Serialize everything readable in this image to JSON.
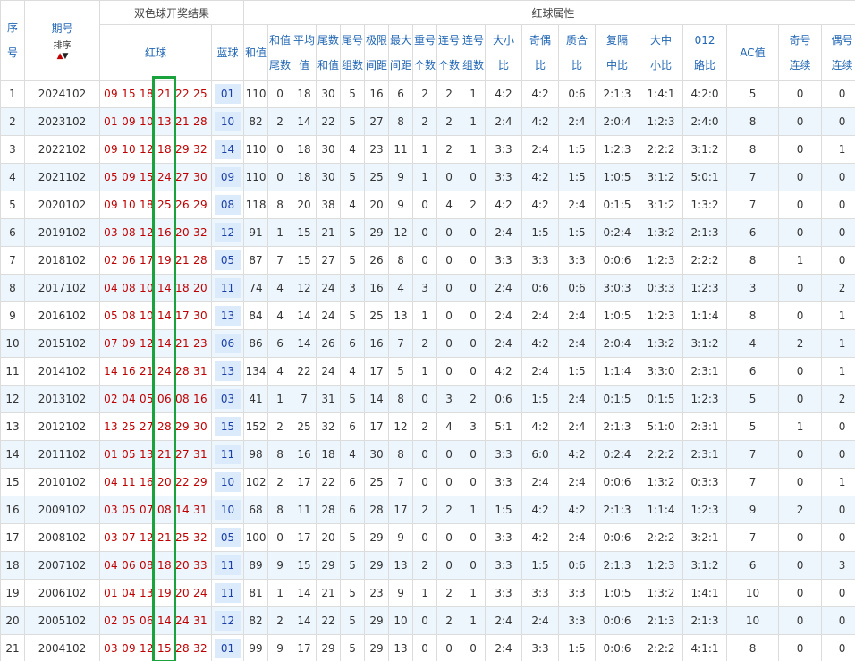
{
  "header": {
    "seq": [
      "序",
      "号"
    ],
    "period": "期号",
    "sort_label": "排序",
    "group_result": "双色球开奖结果",
    "group_attr": "红球属性",
    "red": "红球",
    "blue": "蓝球",
    "attr_cols": [
      [
        "和值"
      ],
      [
        "和值",
        "尾数"
      ],
      [
        "平均",
        "值"
      ],
      [
        "尾数",
        "和值"
      ],
      [
        "尾号",
        "组数"
      ],
      [
        "极限",
        "间距"
      ],
      [
        "最大",
        "间距"
      ],
      [
        "重号",
        "个数"
      ],
      [
        "连号",
        "个数"
      ],
      [
        "连号",
        "组数"
      ],
      [
        "大小",
        "比"
      ],
      [
        "奇偶",
        "比"
      ],
      [
        "质合",
        "比"
      ],
      [
        "复隔",
        "中比"
      ],
      [
        "大中",
        "小比"
      ],
      [
        "012",
        "路比"
      ],
      [
        "AC值"
      ],
      [
        "奇号",
        "连续"
      ],
      [
        "偶号",
        "连续"
      ]
    ]
  },
  "rows": [
    [
      "1",
      "2024102",
      "09 15 18 21 22 25",
      "01",
      "110",
      "0",
      "18",
      "30",
      "5",
      "16",
      "6",
      "2",
      "2",
      "1",
      "4:2",
      "4:2",
      "0:6",
      "2:1:3",
      "1:4:1",
      "4:2:0",
      "5",
      "0",
      "0"
    ],
    [
      "2",
      "2023102",
      "01 09 10 13 21 28",
      "10",
      "82",
      "2",
      "14",
      "22",
      "5",
      "27",
      "8",
      "2",
      "2",
      "1",
      "2:4",
      "4:2",
      "2:4",
      "2:0:4",
      "1:2:3",
      "2:4:0",
      "8",
      "0",
      "0"
    ],
    [
      "3",
      "2022102",
      "09 10 12 18 29 32",
      "14",
      "110",
      "0",
      "18",
      "30",
      "4",
      "23",
      "11",
      "1",
      "2",
      "1",
      "3:3",
      "2:4",
      "1:5",
      "1:2:3",
      "2:2:2",
      "3:1:2",
      "8",
      "0",
      "1"
    ],
    [
      "4",
      "2021102",
      "05 09 15 24 27 30",
      "09",
      "110",
      "0",
      "18",
      "30",
      "5",
      "25",
      "9",
      "1",
      "0",
      "0",
      "3:3",
      "4:2",
      "1:5",
      "1:0:5",
      "3:1:2",
      "5:0:1",
      "7",
      "0",
      "0"
    ],
    [
      "5",
      "2020102",
      "09 10 18 25 26 29",
      "08",
      "118",
      "8",
      "20",
      "38",
      "4",
      "20",
      "9",
      "0",
      "4",
      "2",
      "4:2",
      "4:2",
      "2:4",
      "0:1:5",
      "3:1:2",
      "1:3:2",
      "7",
      "0",
      "0"
    ],
    [
      "6",
      "2019102",
      "03 08 12 16 20 32",
      "12",
      "91",
      "1",
      "15",
      "21",
      "5",
      "29",
      "12",
      "0",
      "0",
      "0",
      "2:4",
      "1:5",
      "1:5",
      "0:2:4",
      "1:3:2",
      "2:1:3",
      "6",
      "0",
      "0"
    ],
    [
      "7",
      "2018102",
      "02 06 17 19 21 28",
      "05",
      "87",
      "7",
      "15",
      "27",
      "5",
      "26",
      "8",
      "0",
      "0",
      "0",
      "3:3",
      "3:3",
      "3:3",
      "0:0:6",
      "1:2:3",
      "2:2:2",
      "8",
      "1",
      "0"
    ],
    [
      "8",
      "2017102",
      "04 08 10 14 18 20",
      "11",
      "74",
      "4",
      "12",
      "24",
      "3",
      "16",
      "4",
      "3",
      "0",
      "0",
      "2:4",
      "0:6",
      "0:6",
      "3:0:3",
      "0:3:3",
      "1:2:3",
      "3",
      "0",
      "2"
    ],
    [
      "9",
      "2016102",
      "05 08 10 14 17 30",
      "13",
      "84",
      "4",
      "14",
      "24",
      "5",
      "25",
      "13",
      "1",
      "0",
      "0",
      "2:4",
      "2:4",
      "2:4",
      "1:0:5",
      "1:2:3",
      "1:1:4",
      "8",
      "0",
      "1"
    ],
    [
      "10",
      "2015102",
      "07 09 12 14 21 23",
      "06",
      "86",
      "6",
      "14",
      "26",
      "6",
      "16",
      "7",
      "2",
      "0",
      "0",
      "2:4",
      "4:2",
      "2:4",
      "2:0:4",
      "1:3:2",
      "3:1:2",
      "4",
      "2",
      "1"
    ],
    [
      "11",
      "2014102",
      "14 16 21 24 28 31",
      "13",
      "134",
      "4",
      "22",
      "24",
      "4",
      "17",
      "5",
      "1",
      "0",
      "0",
      "4:2",
      "2:4",
      "1:5",
      "1:1:4",
      "3:3:0",
      "2:3:1",
      "6",
      "0",
      "1"
    ],
    [
      "12",
      "2013102",
      "02 04 05 06 08 16",
      "03",
      "41",
      "1",
      "7",
      "31",
      "5",
      "14",
      "8",
      "0",
      "3",
      "2",
      "0:6",
      "1:5",
      "2:4",
      "0:1:5",
      "0:1:5",
      "1:2:3",
      "5",
      "0",
      "2"
    ],
    [
      "13",
      "2012102",
      "13 25 27 28 29 30",
      "15",
      "152",
      "2",
      "25",
      "32",
      "6",
      "17",
      "12",
      "2",
      "4",
      "3",
      "5:1",
      "4:2",
      "2:4",
      "2:1:3",
      "5:1:0",
      "2:3:1",
      "5",
      "1",
      "0"
    ],
    [
      "14",
      "2011102",
      "01 05 13 21 27 31",
      "11",
      "98",
      "8",
      "16",
      "18",
      "4",
      "30",
      "8",
      "0",
      "0",
      "0",
      "3:3",
      "6:0",
      "4:2",
      "0:2:4",
      "2:2:2",
      "2:3:1",
      "7",
      "0",
      "0"
    ],
    [
      "15",
      "2010102",
      "04 11 16 20 22 29",
      "10",
      "102",
      "2",
      "17",
      "22",
      "6",
      "25",
      "7",
      "0",
      "0",
      "0",
      "3:3",
      "2:4",
      "2:4",
      "0:0:6",
      "1:3:2",
      "0:3:3",
      "7",
      "0",
      "1"
    ],
    [
      "16",
      "2009102",
      "03 05 07 08 14 31",
      "10",
      "68",
      "8",
      "11",
      "28",
      "6",
      "28",
      "17",
      "2",
      "2",
      "1",
      "1:5",
      "4:2",
      "4:2",
      "2:1:3",
      "1:1:4",
      "1:2:3",
      "9",
      "2",
      "0"
    ],
    [
      "17",
      "2008102",
      "03 07 12 21 25 32",
      "05",
      "100",
      "0",
      "17",
      "20",
      "5",
      "29",
      "9",
      "0",
      "0",
      "0",
      "3:3",
      "4:2",
      "2:4",
      "0:0:6",
      "2:2:2",
      "3:2:1",
      "7",
      "0",
      "0"
    ],
    [
      "18",
      "2007102",
      "04 06 08 18 20 33",
      "11",
      "89",
      "9",
      "15",
      "29",
      "5",
      "29",
      "13",
      "2",
      "0",
      "0",
      "3:3",
      "1:5",
      "0:6",
      "2:1:3",
      "1:2:3",
      "3:1:2",
      "6",
      "0",
      "3"
    ],
    [
      "19",
      "2006102",
      "01 04 13 19 20 24",
      "11",
      "81",
      "1",
      "14",
      "21",
      "5",
      "23",
      "9",
      "1",
      "2",
      "1",
      "3:3",
      "3:3",
      "3:3",
      "1:0:5",
      "1:3:2",
      "1:4:1",
      "10",
      "0",
      "0"
    ],
    [
      "20",
      "2005102",
      "02 05 06 14 24 31",
      "12",
      "82",
      "2",
      "14",
      "22",
      "5",
      "29",
      "10",
      "0",
      "2",
      "1",
      "2:4",
      "2:4",
      "3:3",
      "0:0:6",
      "2:1:3",
      "2:1:3",
      "10",
      "0",
      "0"
    ],
    [
      "21",
      "2004102",
      "03 09 12 15 28 32",
      "01",
      "99",
      "9",
      "17",
      "29",
      "5",
      "29",
      "13",
      "0",
      "0",
      "0",
      "2:4",
      "3:3",
      "1:5",
      "0:0:6",
      "2:2:2",
      "4:1:1",
      "8",
      "0",
      "0"
    ]
  ]
}
